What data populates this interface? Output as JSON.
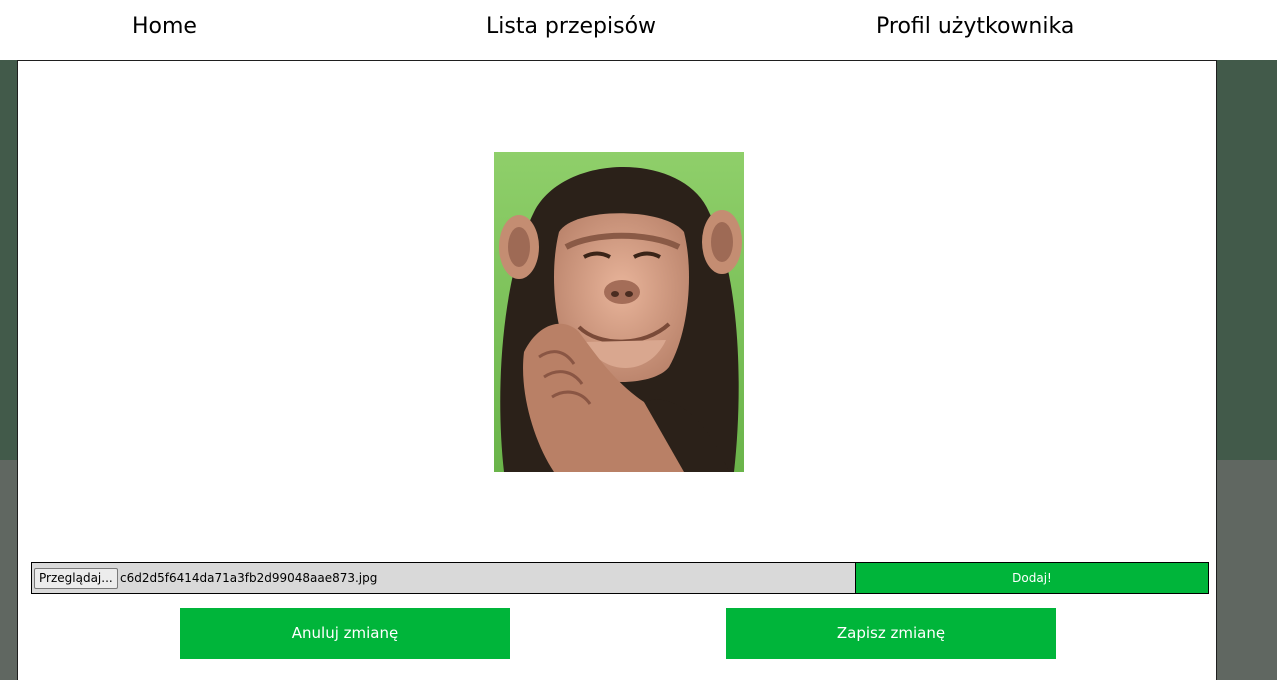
{
  "nav": {
    "home": "Home",
    "recipes": "Lista przepisów",
    "profile": "Profil użytkownika"
  },
  "profile_image": {
    "icon": "chimpanzee-photo"
  },
  "upload": {
    "browse_label": "Przeglądaj...",
    "file_name": "c6d2d5f6414da71a3fb2d99048aae873.jpg",
    "add_label": "Dodaj!"
  },
  "actions": {
    "cancel_label": "Anuluj zmianę",
    "save_label": "Zapisz zmianę"
  },
  "colors": {
    "accent_green": "#00b53a",
    "background_dark_green": "#425a4a",
    "background_gray": "#606761"
  }
}
